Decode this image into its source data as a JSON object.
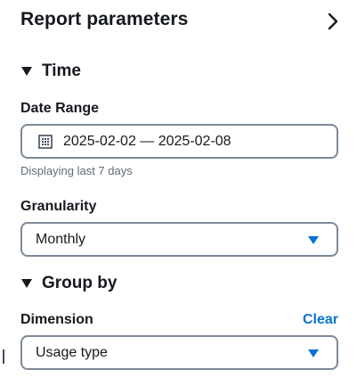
{
  "header": {
    "title": "Report parameters",
    "collapse_icon": "chevron-right-icon"
  },
  "time_section": {
    "title": "Time",
    "expanded": true,
    "date_range": {
      "label": "Date Range",
      "value": "2025-02-02 — 2025-02-08",
      "helper": "Displaying last 7 days",
      "icon": "calendar-icon"
    },
    "granularity": {
      "label": "Granularity",
      "value": "Monthly"
    }
  },
  "group_by_section": {
    "title": "Group by",
    "expanded": true,
    "dimension": {
      "label": "Dimension",
      "clear_label": "Clear",
      "value": "Usage type"
    }
  },
  "colors": {
    "accent": "#0972d3",
    "text": "#16191f",
    "muted": "#5f6b7a",
    "border": "#7d8998"
  }
}
